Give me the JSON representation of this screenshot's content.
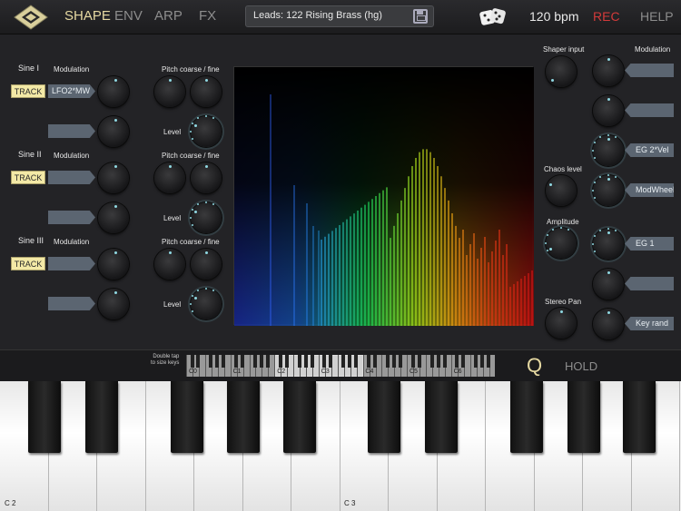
{
  "topbar": {
    "tabs": [
      "SHAPE",
      "ENV",
      "ARP",
      "FX"
    ],
    "active_tab": "SHAPE",
    "preset": "Leads: 122 Rising Brass (hg)",
    "bpm": "120 bpm",
    "rec": "REC",
    "help": "HELP"
  },
  "left": {
    "sections": [
      {
        "title": "Sine I",
        "mod_label": "Modulation",
        "track": "TRACK",
        "mod_tag": "LFO2*MW",
        "pitch_label": "Pitch coarse / fine",
        "level_label": "Level"
      },
      {
        "title": "Sine II",
        "mod_label": "Modulation",
        "track": "TRACK",
        "mod_tag": "",
        "pitch_label": "Pitch coarse / fine",
        "level_label": "Level"
      },
      {
        "title": "Sine III",
        "mod_label": "Modulation",
        "track": "TRACK",
        "mod_tag": "",
        "pitch_label": "Pitch coarse / fine",
        "level_label": "Level"
      }
    ]
  },
  "right": {
    "shaper_label": "Shaper input",
    "mod_label": "Modulation",
    "chaos_label": "Chaos level",
    "amp_label": "Amplitude",
    "pan_label": "Stereo Pan",
    "mod_tags": [
      "",
      "",
      "EG 2*Vel",
      "ModWheel",
      "EG 1",
      "",
      "Key rand"
    ]
  },
  "strip": {
    "hint_line1": "Double tap",
    "hint_line2": "to size keys",
    "octaves": [
      "C0",
      "C1",
      "C2",
      "C3",
      "C4",
      "C5",
      "C6"
    ],
    "q": "Q",
    "hold": "HOLD"
  },
  "piano": {
    "labels": [
      "C 2",
      "C 3"
    ]
  },
  "colors": {
    "accent": "#e6d9a2",
    "rec": "#d23a3a",
    "knob_dot": "#8fd8e2",
    "tag": "#5b6571",
    "track": "#f3e9a6"
  }
}
